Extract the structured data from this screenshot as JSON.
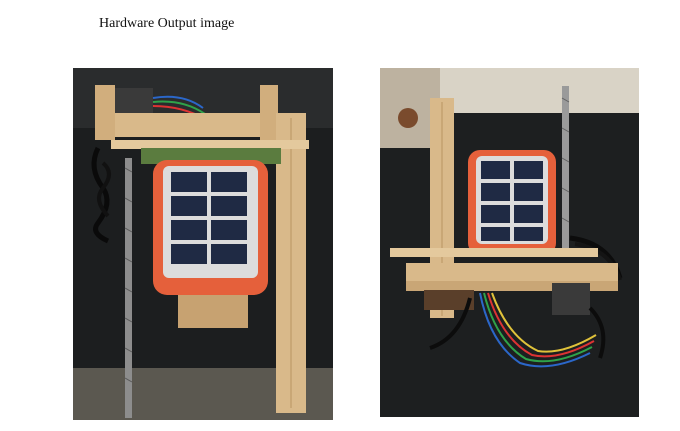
{
  "document": {
    "caption": "Hardware Output image"
  },
  "figures": [
    {
      "id": "photo-left",
      "subject": "solar-panel-on-wooden-frame-top-view"
    },
    {
      "id": "photo-right",
      "subject": "solar-panel-on-wooden-frame-angled-view"
    }
  ],
  "colors": {
    "page_bg": "#ffffff",
    "bench_dark": "#1c1e1f",
    "plywood": "#d9b98a",
    "panel_orange": "#e5603b",
    "cell_blue": "#1f2a44"
  }
}
